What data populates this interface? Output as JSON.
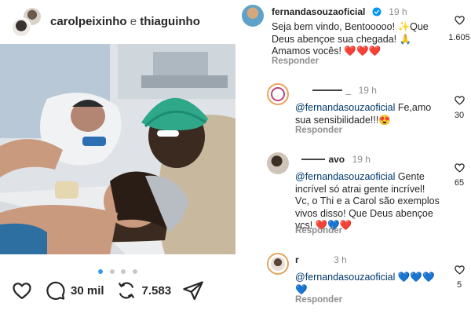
{
  "post": {
    "header": {
      "user1": "carolpeixinho",
      "separator": "e",
      "user2": "thiaguinho"
    },
    "carousel": {
      "count": 4,
      "active": 0
    },
    "actions": {
      "comments_count": "30 mil",
      "reposts_count": "7.583"
    }
  },
  "comments": {
    "main": {
      "username": "fernandasouzaoficial",
      "time": "19 h",
      "text": "Seja bem vindo, Bentooooo! ✨Que Deus abençoe sua chegada! 🙏 Amamos vocês! ❤️❤️❤️",
      "line1": "Seja bem vindo, Bentooooo! ✨Que",
      "line2": "Deus abençoe sua chegada! 🙏",
      "line3": "Amamos vocês! ❤️❤️❤️",
      "likes": "1.605",
      "reply_label": "Responder"
    },
    "reply1": {
      "username_suffix": "_",
      "time": "19 h",
      "mention": "@fernandasouzaoficial",
      "text_l1": " Fe,amo",
      "text_l2": "sua sensibilidade!!!😍",
      "likes": "30",
      "reply_label": "Responder"
    },
    "reply2": {
      "username": "avo",
      "time": "19 h",
      "mention": "@fernandasouzaoficial",
      "text_l1": " Gente",
      "text_l2": "incrível só atrai gente incrível!",
      "text_l3": "Vc, o Thi e a Carol são exemplos",
      "text_l4": "vivos disso! Que Deus abençoe",
      "text_l5": "vcs! ❤️💙❤️",
      "likes": "65",
      "reply_label": "Responder"
    },
    "reply3": {
      "username": "r",
      "time": "3 h",
      "mention": "@fernandasouzaoficial",
      "text_l1": " 💙💙💙",
      "text_l2": "💙",
      "likes": "5",
      "reply_label": "Responder"
    }
  },
  "colors": {
    "verified": "#0095f6",
    "mention": "#00376b",
    "muted": "#8e8e8e",
    "carousel_active": "#3897f0"
  },
  "icons": [
    "heart-icon",
    "comment-icon",
    "repost-icon",
    "share-icon",
    "verified-icon"
  ]
}
